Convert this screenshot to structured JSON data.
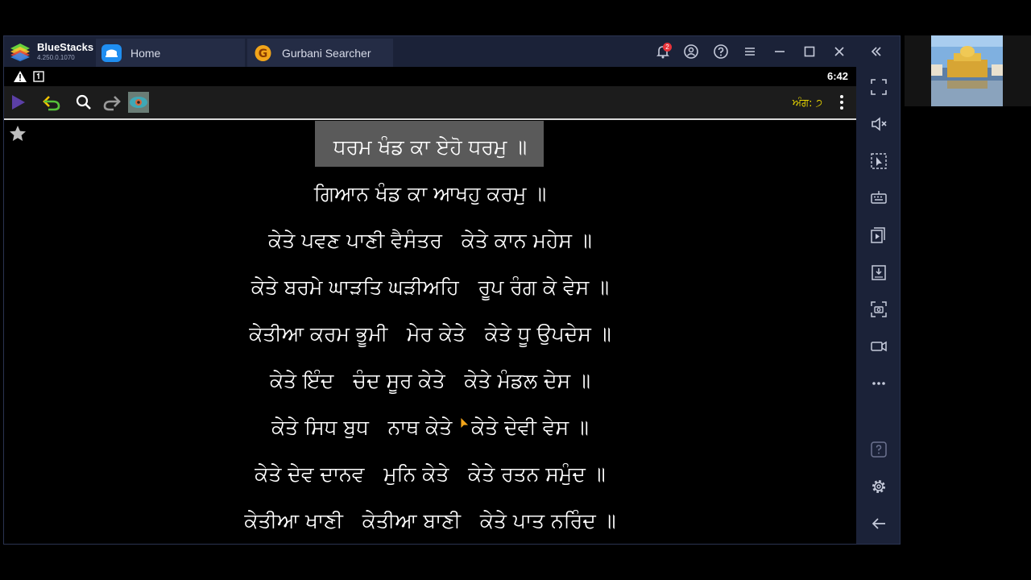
{
  "titlebar": {
    "brand": "BlueStacks",
    "version": "4.250.0.1070",
    "tabs": [
      {
        "label": "Home",
        "icon": "home-icon"
      },
      {
        "label": "Gurbani Searcher",
        "icon": "gurbani-app-icon"
      }
    ],
    "notification_count": "2",
    "controls": [
      "bell-icon",
      "account-icon",
      "help-icon",
      "menu-icon",
      "minimize-icon",
      "maximize-icon",
      "close-icon",
      "collapse-sidebar-icon"
    ]
  },
  "statusbar": {
    "time": "6:42",
    "icons": [
      "warning-icon",
      "sim-icon"
    ]
  },
  "appbar": {
    "ang_label": "ਅੰਗ: ੭",
    "buttons": [
      "play-icon",
      "undo-icon",
      "search-icon",
      "redo-icon",
      "app-image-icon",
      "overflow-menu-icon"
    ]
  },
  "content": {
    "lines": [
      "ਧਰਮ ਖੰਡ ਕਾ ਏਹੋ ਧਰਮੁ ॥",
      "ਗਿਆਨ ਖੰਡ ਕਾ ਆਖਹੁ ਕਰਮੁ ॥",
      "ਕੇਤੇ ਪਵਣ ਪਾਣੀ ਵੈਸੰਤਰ   ਕੇਤੇ ਕਾਨ ਮਹੇਸ ॥",
      "ਕੇਤੇ ਬਰਮੇ ਘਾੜਤਿ ਘੜੀਅਹਿ   ਰੂਪ ਰੰਗ ਕੇ ਵੇਸ ॥",
      "ਕੇਤੀਆ ਕਰਮ ਭੂਮੀ   ਮੇਰ ਕੇਤੇ   ਕੇਤੇ ਧੂ ਉਪਦੇਸ ॥",
      "ਕੇਤੇ ਇੰਦ   ਚੰਦ ਸੂਰ ਕੇਤੇ   ਕੇਤੇ ਮੰਡਲ ਦੇਸ ॥",
      "ਕੇਤੇ ਸਿਧ ਬੁਧ   ਨਾਥ ਕੇਤੇ   ਕੇਤੇ ਦੇਵੀ ਵੇਸ ॥",
      "ਕੇਤੇ ਦੇਵ ਦਾਨਵ   ਮੁਨਿ ਕੇਤੇ   ਕੇਤੇ ਰਤਨ ਸਮੁੰਦ ॥",
      "ਕੇਤੀਆ ਖਾਣੀ   ਕੇਤੀਆ ਬਾਣੀ   ਕੇਤੇ ਪਾਤ ਨਰਿੰਦ ॥"
    ],
    "highlighted_line": 0
  },
  "sidebar": [
    "fullscreen-icon",
    "mute-icon",
    "pointer-icon",
    "keyboard-icon",
    "media-manager-icon",
    "install-apk-icon",
    "screenshot-icon",
    "record-icon",
    "more-icon",
    "help-icon",
    "settings-icon",
    "back-icon"
  ],
  "colors": {
    "chrome": "#1b2238",
    "tab": "#242c45",
    "ang": "#e8d600",
    "highlight": "#5a5a5a"
  }
}
